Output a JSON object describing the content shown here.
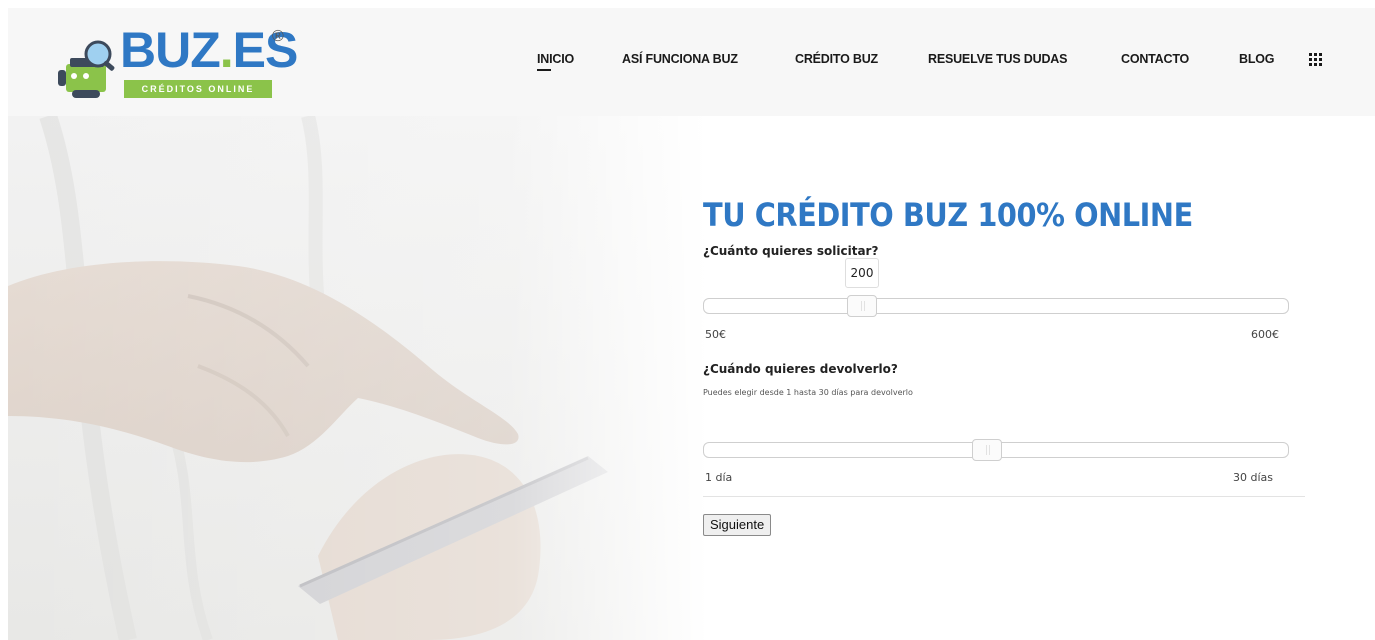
{
  "brand": {
    "name_part1": "BUZ",
    "name_dot": ".",
    "name_part2": "ES",
    "registered": "®",
    "tagline": "CRÉDITOS ONLINE",
    "primary_color": "#2f78c4",
    "accent_color": "#8bc34a"
  },
  "nav": {
    "items": [
      {
        "label": "INICIO",
        "active": true
      },
      {
        "label": "ASÍ FUNCIONA BUZ",
        "active": false
      },
      {
        "label": "CRÉDITO BUZ",
        "active": false
      },
      {
        "label": "RESUELVE TUS DUDAS",
        "active": false
      },
      {
        "label": "CONTACTO",
        "active": false
      },
      {
        "label": "BLOG",
        "active": false
      }
    ],
    "menu_icon": "grid-icon"
  },
  "form": {
    "title": "TU CRÉDITO BUZ 100% ONLINE",
    "amount": {
      "question": "¿Cuánto quieres solicitar?",
      "value": "200",
      "min_label": "50€",
      "max_label": "600€",
      "min": 50,
      "max": 600,
      "current": 200
    },
    "term": {
      "question": "¿Cuándo quieres devolverlo?",
      "hint": "Puedes elegir desde 1 hasta 30 días para devolverlo",
      "min_label": "1 día",
      "max_label": "30 días",
      "min": 1,
      "max": 30,
      "current": 16
    },
    "submit_label": "Siguiente"
  }
}
